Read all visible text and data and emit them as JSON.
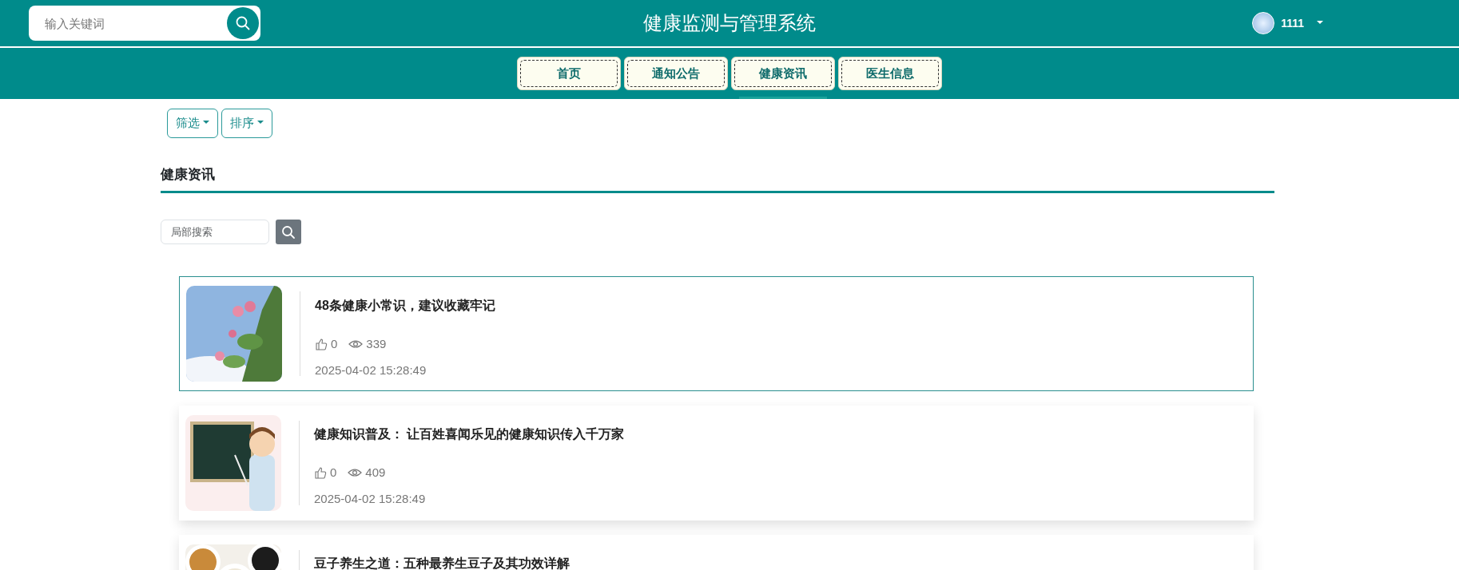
{
  "header": {
    "search": {
      "placeholder": "输入关键词"
    },
    "title": "健康监测与管理系统",
    "user": {
      "name": "1111"
    }
  },
  "nav": [
    {
      "label": "首页",
      "selected": false
    },
    {
      "label": "通知公告",
      "selected": false
    },
    {
      "label": "健康资讯",
      "selected": true
    },
    {
      "label": "医生信息",
      "selected": false
    }
  ],
  "toolbar": [
    "筛选",
    "排序"
  ],
  "section": {
    "heading": "健康资讯",
    "search": {
      "placeholder": "局部搜索"
    }
  },
  "articles": [
    {
      "title": "48条健康小常识，建议收藏牢记",
      "likes": "0",
      "views": "339",
      "date": "2025-04-02 15:28:49",
      "highlighted": true,
      "kind": "picture"
    },
    {
      "title": "健康知识普及： 让百姓喜闻乐见的健康知识传入千万家",
      "likes": "0",
      "views": "409",
      "date": "2025-04-02 15:28:49",
      "highlighted": false,
      "kind": "picture"
    },
    {
      "title": "豆子养生之道：五种最养生豆子及其功效详解",
      "highlighted": false,
      "kind": "picture"
    }
  ]
}
